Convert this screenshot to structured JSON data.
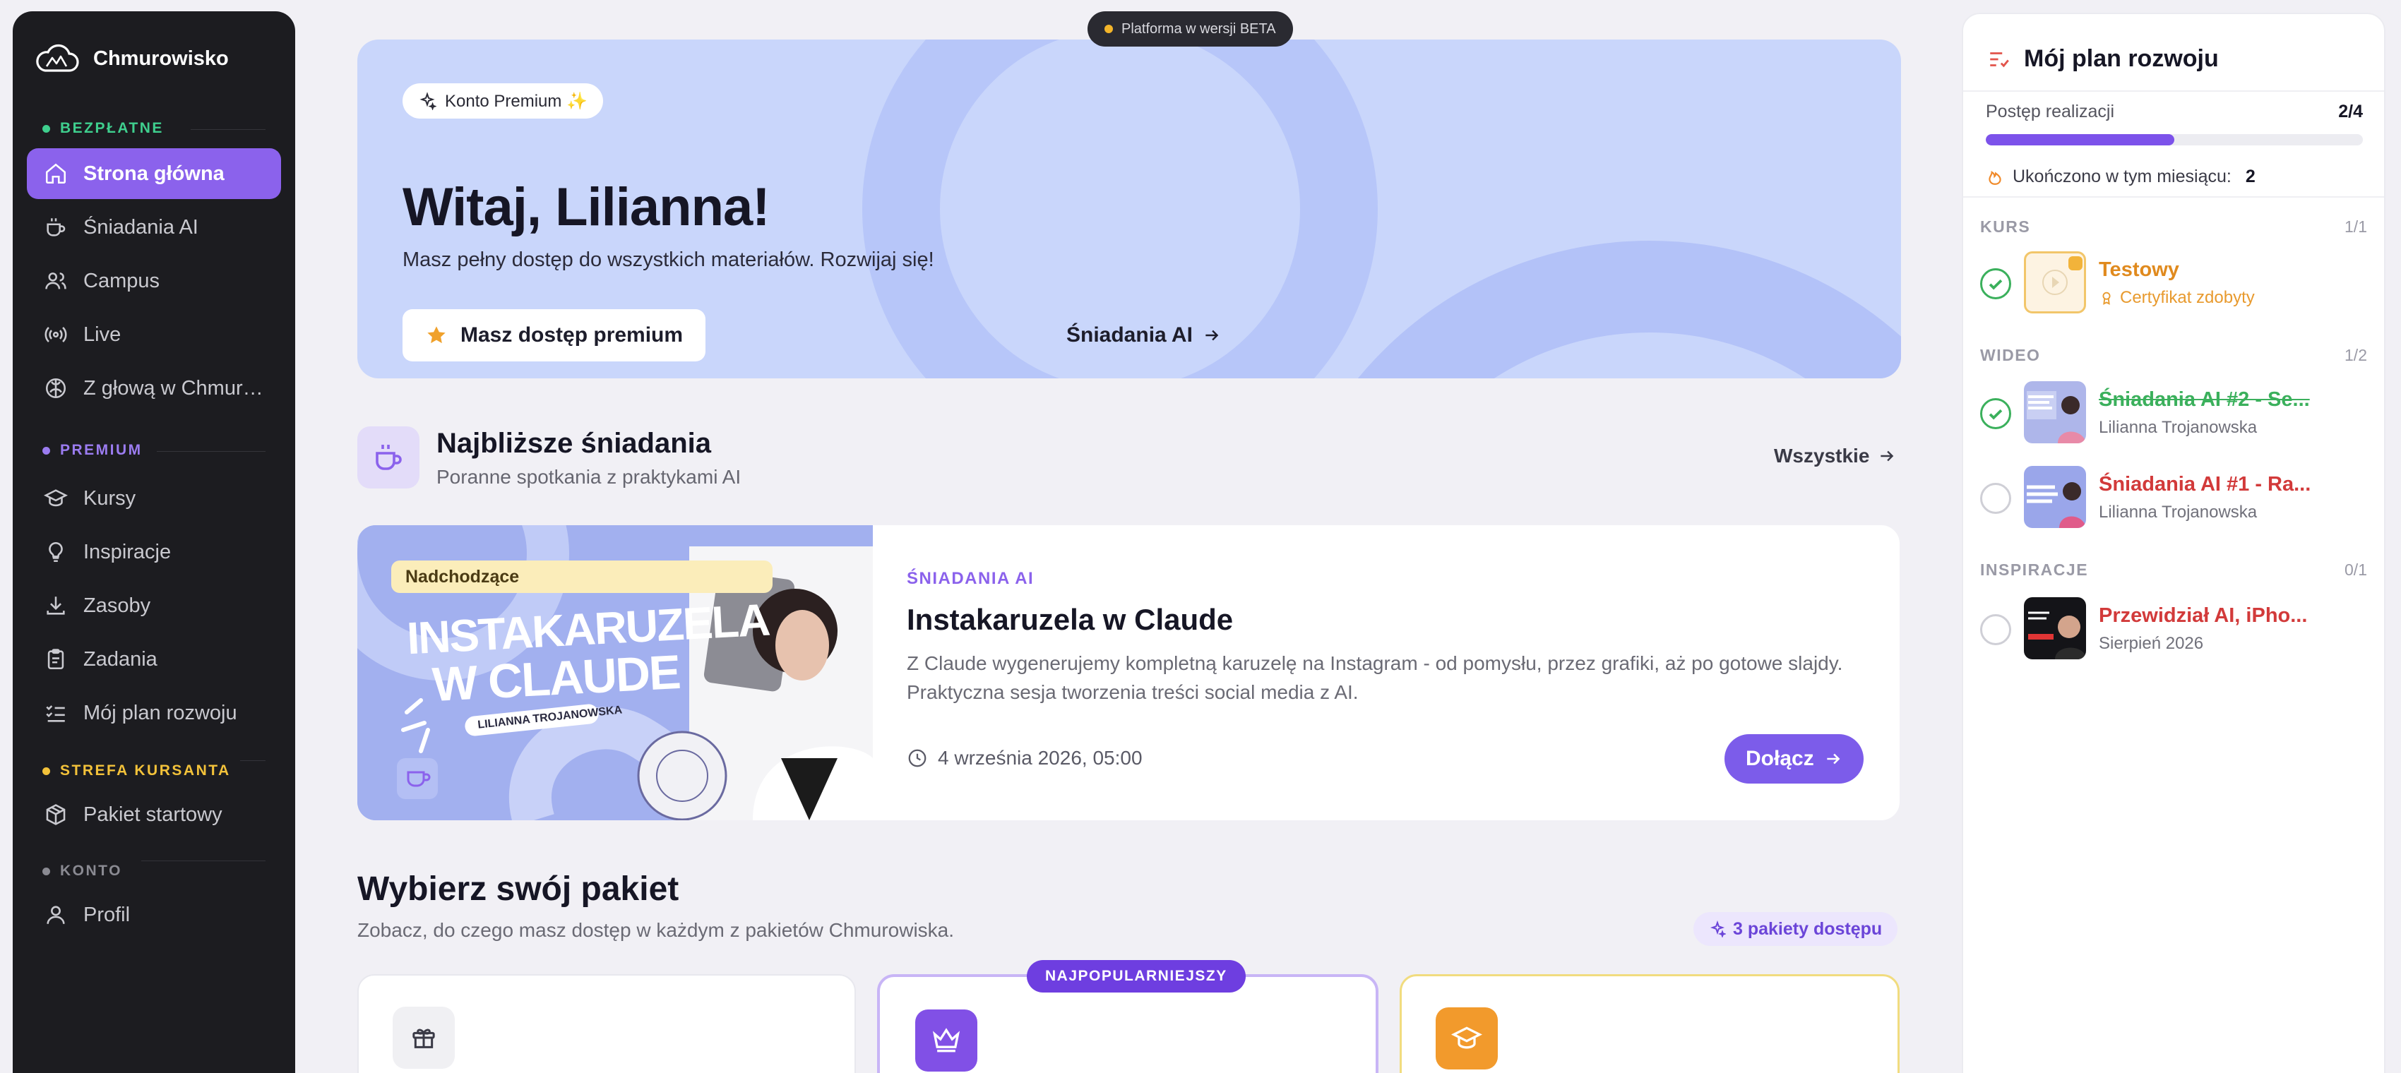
{
  "brand": {
    "name": "Chmurowisko"
  },
  "sidebar": {
    "sections": {
      "free": "BEZPŁATNE",
      "premium": "PREMIUM",
      "student": "STREFA KURSANTA",
      "account": "KONTO"
    },
    "section_colors": {
      "free": "#3fcf8e",
      "premium": "#9b7cf0",
      "student": "#f3c23a",
      "account": "#8a8a92"
    },
    "items": [
      {
        "label": "Strona główna",
        "icon": "home-icon",
        "active": true
      },
      {
        "label": "Śniadania AI",
        "icon": "coffee-icon"
      },
      {
        "label": "Campus",
        "icon": "users-icon"
      },
      {
        "label": "Live",
        "icon": "broadcast-icon"
      },
      {
        "label": "Z głową w Chmurowisku",
        "icon": "brain-icon"
      },
      {
        "label": "Kursy",
        "icon": "graduation-cap-icon"
      },
      {
        "label": "Inspiracje",
        "icon": "lightbulb-icon"
      },
      {
        "label": "Zasoby",
        "icon": "download-icon"
      },
      {
        "label": "Zadania",
        "icon": "clipboard-icon"
      },
      {
        "label": "Mój plan rozwoju",
        "icon": "list-check-icon"
      },
      {
        "label": "Pakiet startowy",
        "icon": "package-icon"
      },
      {
        "label": "Profil",
        "icon": "user-icon"
      }
    ]
  },
  "beta_badge": "Platforma w wersji BETA",
  "hero": {
    "chip": "Konto Premium ✨",
    "title": "Witaj, Lilianna!",
    "subtitle": "Masz pełny dostęp do wszystkich materiałów. Rozwijaj się!",
    "premium_button": "Masz dostęp premium",
    "link": "Śniadania AI"
  },
  "breakfasts": {
    "title": "Najbliższe śniadania",
    "subtitle": "Poranne spotkania z praktykami AI",
    "all_link": "Wszystkie",
    "event": {
      "badge": "Nadchodzące",
      "kicker": "ŚNIADANIA AI",
      "title": "Instakaruzela w Claude",
      "description": "Z Claude wygenerujemy kompletną karuzelę na Instagram - od pomysłu, przez grafiki, aż po gotowe slajdy. Praktyczna sesja tworzenia treści social media z AI.",
      "date": "4 września 2026, 05:00",
      "join_button": "Dołącz",
      "image_text": {
        "line1": "INSTAKARUZELA",
        "line2": "W CLAUDE",
        "presenter": "LILIANNA TROJANOWSKA"
      }
    }
  },
  "packages": {
    "title": "Wybierz swój pakiet",
    "subtitle": "Zobacz, do czego masz dostęp w każdym z pakietów Chmurowiska.",
    "chip": "3 pakiety dostępu",
    "popular_ribbon": "NAJPOPULARNIEJSZY",
    "cards": [
      {
        "icon": "gift-icon"
      },
      {
        "icon": "crown-icon"
      },
      {
        "icon": "graduation-cap-icon"
      }
    ]
  },
  "plan": {
    "title": "Mój plan rozwoju",
    "progress_label": "Postęp realizacji",
    "progress_value": "2/4",
    "progress_fraction": 0.5,
    "month_label": "Ukończono w tym miesiącu:",
    "month_value": "2",
    "groups": [
      {
        "label": "KURS",
        "count": "1/1",
        "items": [
          {
            "title": "Testowy",
            "meta": "Certyfikat zdobyty",
            "status": "done",
            "color": "#e08a1e"
          }
        ]
      },
      {
        "label": "WIDEO",
        "count": "1/2",
        "items": [
          {
            "title": "Śniadania AI #2 - Se...",
            "meta": "Lilianna Trojanowska",
            "status": "done",
            "color": "#3bb05c",
            "strike": true
          },
          {
            "title": "Śniadania AI #1 - Ra...",
            "meta": "Lilianna Trojanowska",
            "status": "todo",
            "color": "#d23a3a"
          }
        ]
      },
      {
        "label": "INSPIRACJE",
        "count": "0/1",
        "items": [
          {
            "title": "Przewidział AI, iPho...",
            "meta": "Sierpień 2026",
            "status": "todo",
            "color": "#d23a3a"
          }
        ]
      }
    ]
  }
}
